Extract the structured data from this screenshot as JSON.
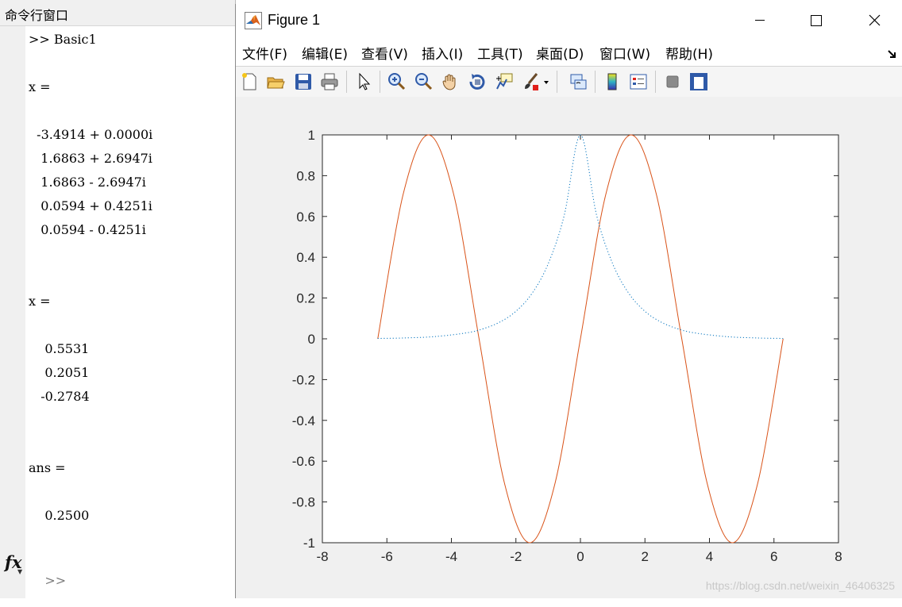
{
  "command_window": {
    "title": "命令行窗口",
    "lines": [
      ">> Basic1",
      "",
      "x =",
      "",
      "  -3.4914 + 0.0000i",
      "   1.6863 + 2.6947i",
      "   1.6863 - 2.6947i",
      "   0.0594 + 0.4251i",
      "   0.0594 - 0.4251i",
      "",
      "",
      "x =",
      "",
      "    0.5531",
      "    0.2051",
      "   -0.2784",
      "",
      "",
      "ans =",
      "",
      "    0.2500",
      ""
    ],
    "prompt": ">>",
    "fx_label": "fx"
  },
  "figure": {
    "title": "Figure 1",
    "menus": [
      "文件(F)",
      "编辑(E)",
      "查看(V)",
      "插入(I)",
      "工具(T)",
      "桌面(D)",
      "窗口(W)",
      "帮助(H)"
    ],
    "toolbar_icons": [
      "new-figure-icon",
      "open-file-icon",
      "save-icon",
      "print-icon",
      "edit-plot-icon",
      "zoom-in-icon",
      "zoom-out-icon",
      "pan-icon",
      "rotate-3d-icon",
      "data-cursor-icon",
      "brush-icon",
      "link-plot-icon",
      "colorbar-icon",
      "legend-icon",
      "hide-plot-tools-icon",
      "show-plot-tools-icon"
    ]
  },
  "watermark": "https://blog.csdn.net/weixin_46406325",
  "colors": {
    "sin_line": "#D95319",
    "dotted_line": "#0072BD"
  },
  "chart_data": {
    "type": "line",
    "xlim": [
      -8,
      8
    ],
    "ylim": [
      -1,
      1
    ],
    "xticks": [
      "-8",
      "-6",
      "-4",
      "-2",
      "0",
      "2",
      "4",
      "6",
      "8"
    ],
    "yticks": [
      "1",
      "0.8",
      "0.6",
      "0.4",
      "0.2",
      "0",
      "-0.2",
      "-0.4",
      "-0.6",
      "-0.8",
      "-1"
    ],
    "grid": false,
    "series": [
      {
        "style": "solid",
        "color": "#D95319",
        "x": [
          -6.283,
          -5.498,
          -4.712,
          -3.927,
          -3.142,
          -2.356,
          -1.571,
          -0.785,
          0,
          0.785,
          1.571,
          2.356,
          3.142,
          3.927,
          4.712,
          5.498,
          6.283
        ],
        "y": [
          0,
          0.707,
          1,
          0.707,
          0,
          -0.707,
          -1,
          -0.707,
          0,
          0.707,
          1,
          0.707,
          0,
          -0.707,
          -1,
          -0.707,
          0
        ]
      },
      {
        "style": "dotted",
        "color": "#0072BD",
        "x": [
          -6.283,
          -5.5,
          -4.5,
          -3.5,
          -3,
          -2.5,
          -2,
          -1.5,
          -1,
          -0.5,
          0,
          0.5,
          1,
          1.5,
          2,
          2.5,
          3,
          3.5,
          4.5,
          5.5,
          6.283
        ],
        "y": [
          0.002,
          0.004,
          0.011,
          0.03,
          0.05,
          0.082,
          0.135,
          0.223,
          0.368,
          0.607,
          1,
          0.607,
          0.368,
          0.223,
          0.135,
          0.082,
          0.05,
          0.03,
          0.011,
          0.004,
          0.002
        ]
      }
    ]
  }
}
